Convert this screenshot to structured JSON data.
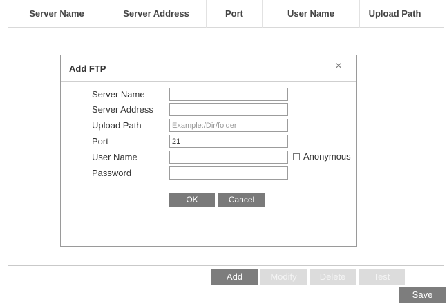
{
  "table": {
    "columns": [
      "Server Name",
      "Server Address",
      "Port",
      "User Name",
      "Upload Path"
    ]
  },
  "dialog": {
    "title": "Add FTP",
    "close_glyph": "×",
    "fields": {
      "server_name": {
        "label": "Server Name",
        "value": ""
      },
      "server_address": {
        "label": "Server Address",
        "value": ""
      },
      "upload_path": {
        "label": "Upload Path",
        "value": "",
        "placeholder": "Example:/Dir/folder"
      },
      "port": {
        "label": "Port",
        "value": "21"
      },
      "user_name": {
        "label": "User Name",
        "value": ""
      },
      "password": {
        "label": "Password",
        "value": ""
      }
    },
    "anonymous": {
      "label": "Anonymous",
      "checked": false
    },
    "ok_label": "OK",
    "cancel_label": "Cancel"
  },
  "actions": {
    "add_label": "Add",
    "modify_label": "Modify",
    "delete_label": "Delete",
    "test_label": "Test",
    "save_label": "Save"
  },
  "colors": {
    "button_active": "#7d7d7d",
    "button_disabled": "#dcdcdc",
    "border": "#c9c9c9"
  }
}
